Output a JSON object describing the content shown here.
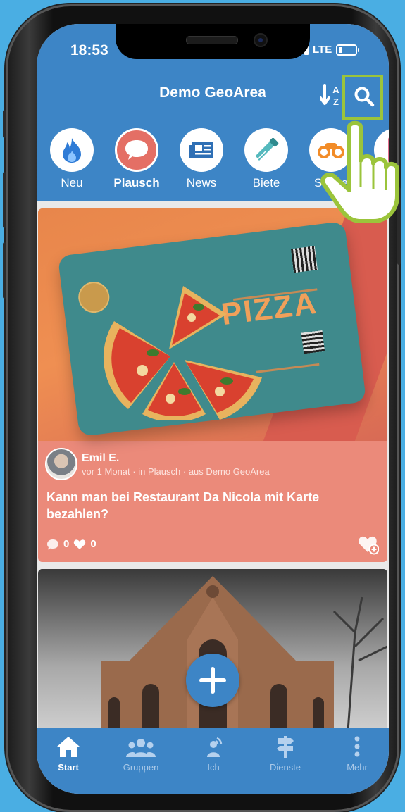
{
  "status": {
    "time": "18:53",
    "network": "LTE"
  },
  "header": {
    "title": "Demo GeoArea",
    "sort_label": "A Z"
  },
  "categories": [
    {
      "label": "Neu"
    },
    {
      "label": "Plausch"
    },
    {
      "label": "News"
    },
    {
      "label": "Biete"
    },
    {
      "label": "Suche"
    }
  ],
  "post": {
    "image_text": "PIZZA",
    "author": "Emil E.",
    "age": "vor 1 Monat",
    "sep1": "·",
    "category": "in Plausch",
    "sep2": "·",
    "area": "aus Demo GeoArea",
    "title": "Kann man bei Restaurant Da Nicola mit Karte bezahlen?",
    "comments": "0",
    "likes": "0"
  },
  "tabs": [
    {
      "label": "Start"
    },
    {
      "label": "Gruppen"
    },
    {
      "label": "Ich"
    },
    {
      "label": "Dienste"
    },
    {
      "label": "Mehr"
    }
  ],
  "colors": {
    "primary": "#3d85c6",
    "card": "#eb8a7a",
    "highlight": "#9bc43b",
    "active_category": "#e46f65"
  }
}
